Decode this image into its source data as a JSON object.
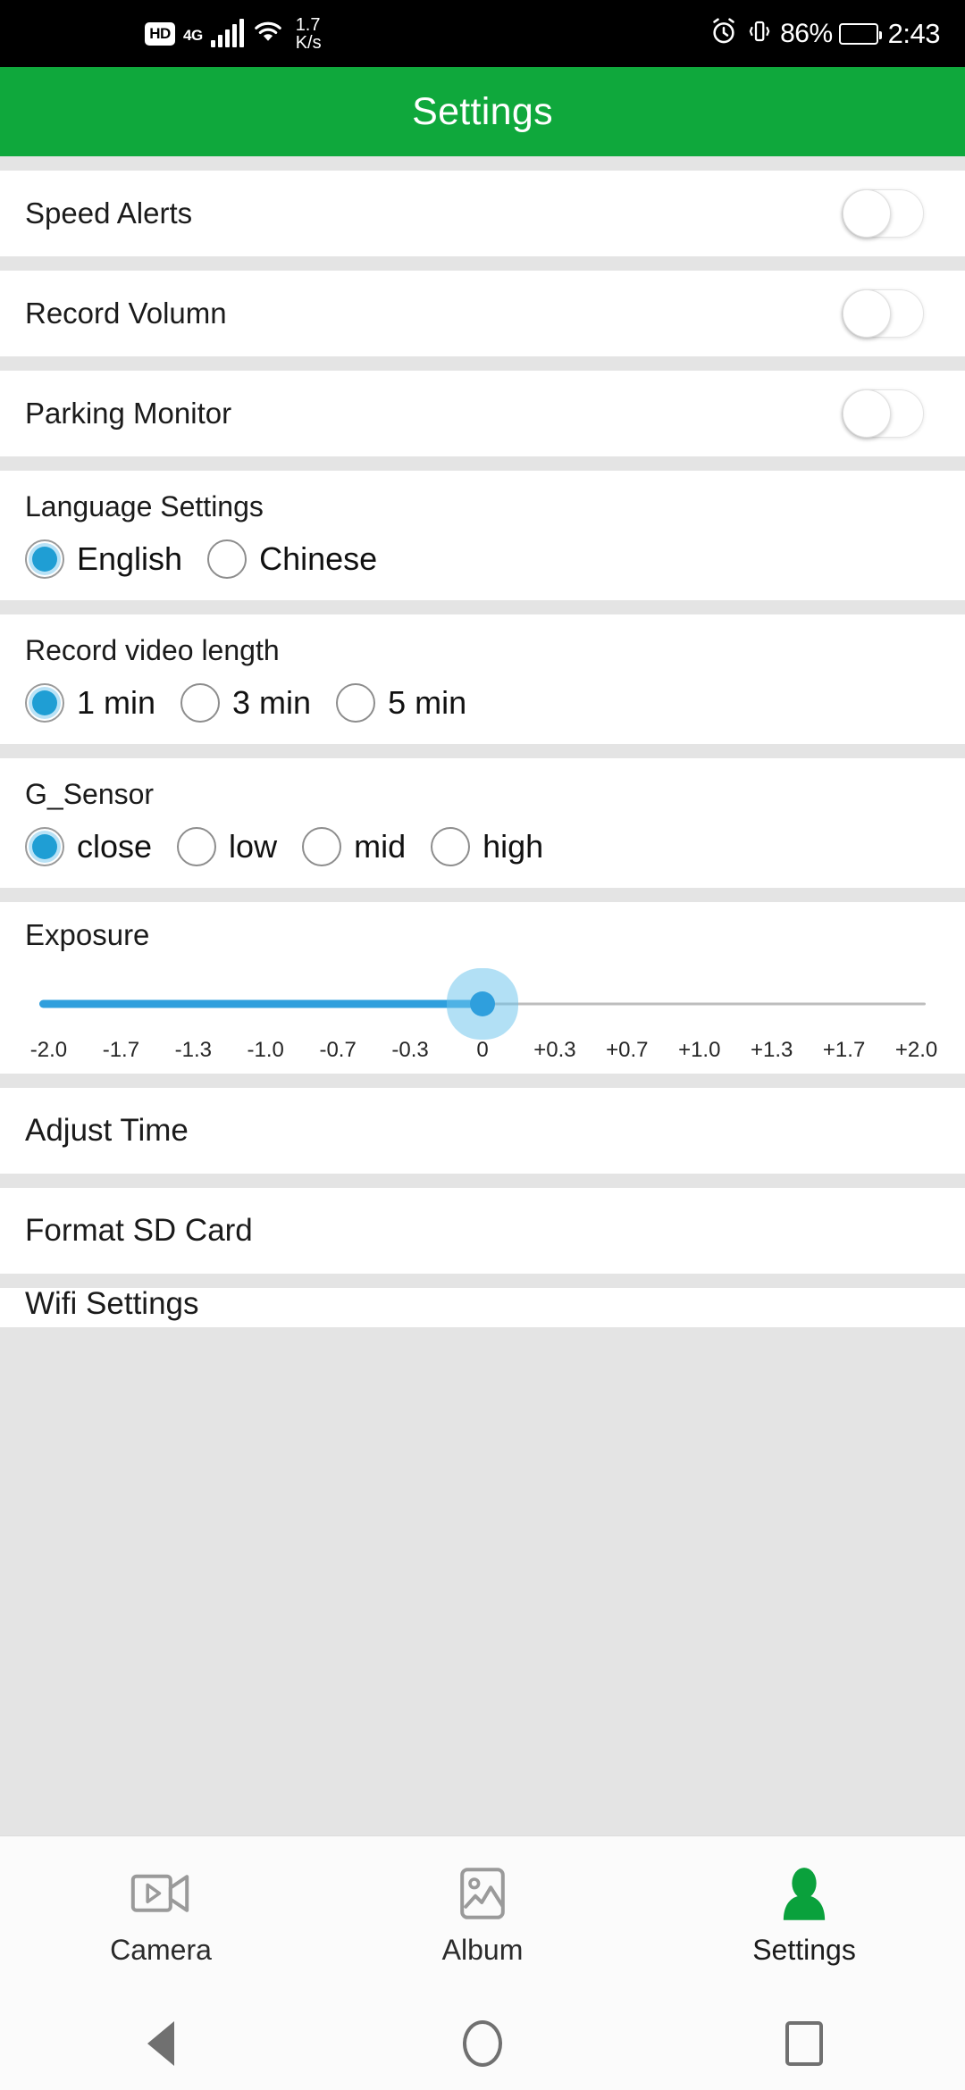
{
  "status_bar": {
    "hd_badge": "HD",
    "network": "4G",
    "signal_icon": "signal-bars-icon",
    "wifi_icon": "wifi-icon",
    "speed_value": "1.7",
    "speed_unit": "K/s",
    "alarm_icon": "alarm-clock-icon",
    "vibrate_icon": "vibrate-icon",
    "battery_percent": "86%",
    "battery_icon": "battery-icon",
    "clock": "2:43"
  },
  "header": {
    "title": "Settings",
    "background_color": "#0fa83c"
  },
  "toggles": [
    {
      "label": "Speed Alerts",
      "state": "off"
    },
    {
      "label": "Record Volumn",
      "state": "off"
    },
    {
      "label": "Parking Monitor",
      "state": "off"
    }
  ],
  "language_group": {
    "title": "Language Settings",
    "options": [
      {
        "label": "English",
        "selected": true
      },
      {
        "label": "Chinese",
        "selected": false
      }
    ]
  },
  "video_length_group": {
    "title": "Record video length",
    "options": [
      {
        "label": "1 min",
        "selected": true
      },
      {
        "label": "3 min",
        "selected": false
      },
      {
        "label": "5 min",
        "selected": false
      }
    ]
  },
  "gsensor_group": {
    "title": "G_Sensor",
    "options": [
      {
        "label": "close",
        "selected": true
      },
      {
        "label": "low",
        "selected": false
      },
      {
        "label": "mid",
        "selected": false
      },
      {
        "label": "high",
        "selected": false
      }
    ]
  },
  "exposure": {
    "title": "Exposure",
    "value": "0",
    "fill_percent": 50,
    "accent_color": "#2f9fdd",
    "ticks": [
      "-2.0",
      "-1.7",
      "-1.3",
      "-1.0",
      "-0.7",
      "-0.3",
      "0",
      "+0.3",
      "+0.7",
      "+1.0",
      "+1.3",
      "+1.7",
      "+2.0"
    ]
  },
  "nav_rows": [
    {
      "label": "Adjust Time"
    },
    {
      "label": "Format SD Card"
    },
    {
      "label": "Wifi Settings"
    }
  ],
  "tabbar": {
    "active_color": "#0fa83c",
    "inactive_color": "#9a9a9a",
    "tabs": [
      {
        "label": "Camera",
        "icon": "video-camera-icon",
        "active": false
      },
      {
        "label": "Album",
        "icon": "image-icon",
        "active": false
      },
      {
        "label": "Settings",
        "icon": "person-icon",
        "active": true
      }
    ]
  },
  "android_nav": {
    "back": "back-triangle-icon",
    "home": "home-circle-icon",
    "recents": "recents-square-icon"
  }
}
